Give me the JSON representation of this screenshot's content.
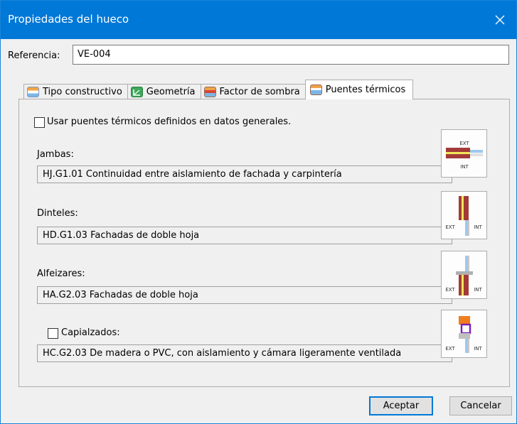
{
  "window": {
    "title": "Propiedades del hueco"
  },
  "reference": {
    "label": "Referencia:",
    "value": "VE-004"
  },
  "tabs": [
    {
      "label": "Tipo constructivo",
      "icon": "construction-type-icon"
    },
    {
      "label": "Geometría",
      "icon": "geometry-icon"
    },
    {
      "label": "Factor de sombra",
      "icon": "shade-factor-icon"
    },
    {
      "label": "Puentes térmicos",
      "icon": "thermal-bridge-icon",
      "active": true
    }
  ],
  "thermal_bridges": {
    "use_general_label": "Usar puentes térmicos definidos en datos generales.",
    "use_general_checked": false,
    "jambs": {
      "label": "Jambas:",
      "value": "HJ.G1.01 Continuidad entre aislamiento de fachada y carpintería"
    },
    "lintels": {
      "label": "Dinteles:",
      "value": "HD.G1.03 Fachadas de doble hoja"
    },
    "sills": {
      "label": "Alfeizares:",
      "value": "HA.G2.03 Fachadas de doble hoja"
    },
    "capialzados": {
      "label": "Capialzados:",
      "checked": false,
      "value": "HC.G2.03 De madera o PVC, con aislamiento y cámara ligeramente ventilada"
    }
  },
  "diagram_labels": {
    "ext": "EXT",
    "int": "INT"
  },
  "buttons": {
    "accept": "Aceptar",
    "cancel": "Cancelar"
  },
  "colors": {
    "title_bar": "#0078d7",
    "wall": "#a23b37",
    "insulation": "#f2e65a",
    "glazing": "#9cc9ee",
    "box_orange": "#f07d1c",
    "box_purple": "#7a1fb8"
  }
}
